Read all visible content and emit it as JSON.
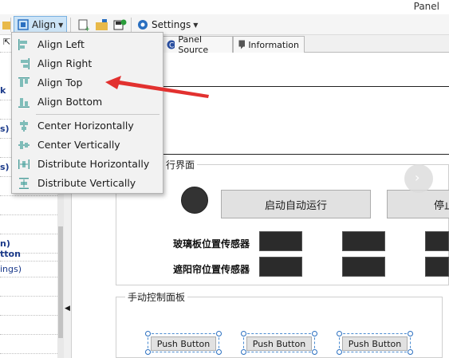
{
  "window": {
    "title": "Panel"
  },
  "toolbar": {
    "align_label": "Align",
    "settings_label": "Settings"
  },
  "tabs": [
    {
      "label": "Panel Source",
      "icon": "c-source-icon"
    },
    {
      "label": "Information",
      "icon": "comment-icon"
    }
  ],
  "left_panel": {
    "rows": [
      {
        "text": "k"
      },
      {
        "text": "s)"
      },
      {
        "text": "s)"
      },
      {
        "text": "n)"
      },
      {
        "text": "tton"
      },
      {
        "text": "ings)"
      }
    ]
  },
  "align_menu": {
    "items": [
      {
        "label": "Align Left",
        "icon": "align-left-icon"
      },
      {
        "label": "Align Right",
        "icon": "align-right-icon"
      },
      {
        "label": "Align Top",
        "icon": "align-top-icon"
      },
      {
        "label": "Align Bottom",
        "icon": "align-bottom-icon"
      },
      {
        "label": "Center Horizontally",
        "icon": "center-horizontally-icon"
      },
      {
        "label": "Center Vertically",
        "icon": "center-vertically-icon"
      },
      {
        "label": "Distribute Horizontally",
        "icon": "distribute-horizontally-icon"
      },
      {
        "label": "Distribute Vertically",
        "icon": "distribute-vertically-icon"
      }
    ]
  },
  "canvas": {
    "group1_title": "行界面",
    "start_auto_button": "启动自动运行",
    "stop_button": "停止",
    "sensor_row1": "玻璃板位置传感器",
    "sensor_row2": "遮阳帘位置传感器",
    "group2_title": "手动控制面板",
    "push_buttons": [
      "Push Button",
      "Push Button",
      "Push Button"
    ]
  },
  "colors": {
    "accent": "#e2312f",
    "menu_icon": "#4a9d9a",
    "highlight": "#cce4f7"
  }
}
